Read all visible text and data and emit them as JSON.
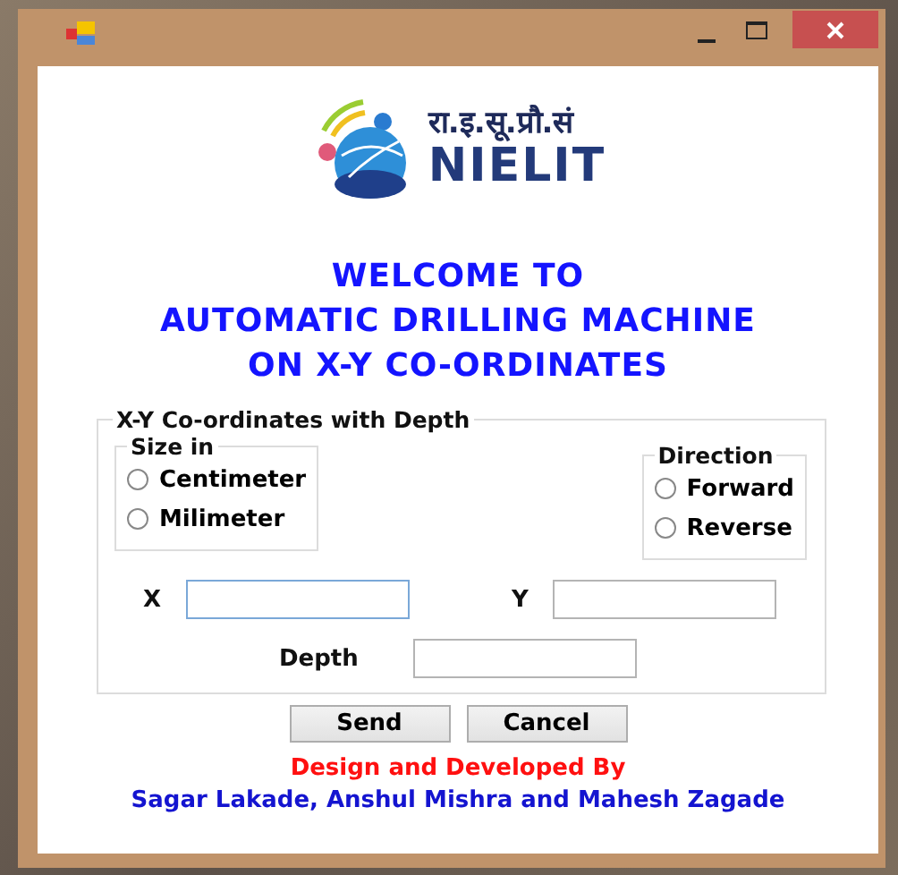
{
  "logo": {
    "hindi": "रा.इ.सू.प्रौ.सं",
    "name": "NIELIT"
  },
  "heading": [
    "WELCOME TO",
    "AUTOMATIC DRILLING MACHINE",
    "ON X-Y CO-ORDINATES"
  ],
  "group": {
    "title": "X-Y Co-ordinates with Depth",
    "size_in": {
      "title": "Size in",
      "options": [
        {
          "label": "Centimeter",
          "selected": false
        },
        {
          "label": "Milimeter",
          "selected": false
        }
      ]
    },
    "direction": {
      "title": "Direction",
      "options": [
        {
          "label": "Forward",
          "selected": false
        },
        {
          "label": "Reverse",
          "selected": false
        }
      ]
    },
    "fields": [
      {
        "label": "X"
      },
      {
        "label": "Y"
      },
      {
        "label": "Depth"
      }
    ]
  },
  "buttons": [
    "Send",
    "Cancel"
  ],
  "credits": {
    "title": "Design and Developed By",
    "authors": "Sagar Lakade, Anshul Mishra and Mahesh Zagade"
  }
}
